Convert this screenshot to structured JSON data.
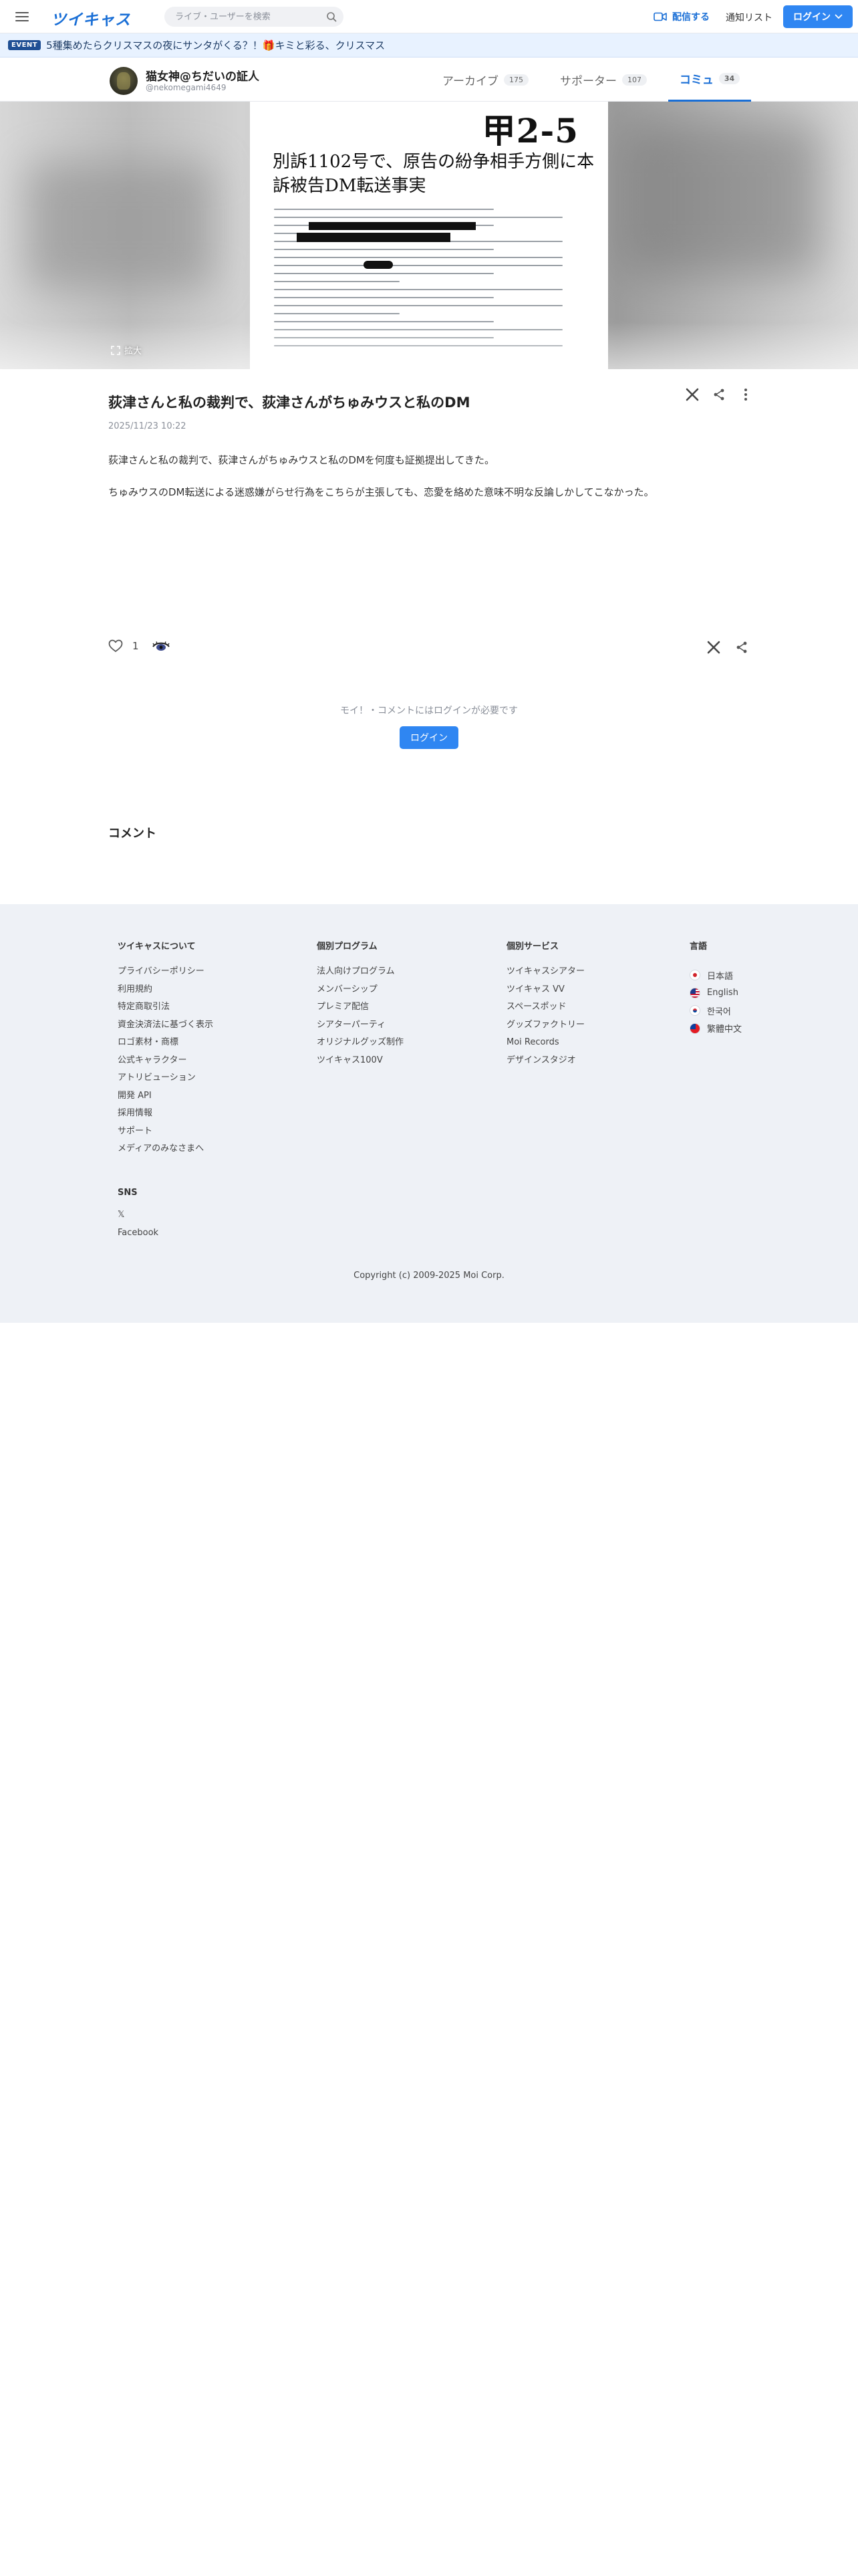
{
  "header": {
    "logo": "ツイキャス",
    "search_placeholder": "ライブ・ユーザーを検索",
    "stream_label": "配信する",
    "notify_label": "通知リスト",
    "login_label": "ログイン"
  },
  "event": {
    "badge": "EVENT",
    "text": "5種集めたらクリスマスの夜にサンタがくる？！🎁キミと彩る、クリスマス"
  },
  "profile": {
    "name": "猫女神@ちだいの証人",
    "user_id": "@nekomegami4649",
    "tabs": [
      {
        "label": "アーカイブ",
        "count": "175"
      },
      {
        "label": "サポーター",
        "count": "107"
      },
      {
        "label": "コミュ",
        "count": "34"
      }
    ]
  },
  "hero": {
    "doc_code": "甲2-5",
    "doc_title": "別訴1102号で、原告の紛争相手方側に本訴被告DM転送事実",
    "expand_label": "拡大"
  },
  "post": {
    "title": "荻津さんと私の裁判で、荻津さんがちゅみウスと私のDM",
    "date": "2025/11/23 10:22",
    "paragraphs": [
      "荻津さんと私の裁判で、荻津さんがちゅみウスと私のDMを何度も証拠提出してきた。",
      "ちゅみウスのDM転送による迷惑嫌がらせ行為をこちらが主張しても、恋愛を絡めた意味不明な反論しかしてこなかった。"
    ],
    "like_count": "1"
  },
  "comments": {
    "login_note": "モイ！・コメントにはログインが必要です",
    "login_button": "ログイン",
    "heading": "コメント"
  },
  "footer": {
    "col1": {
      "heading": "ツイキャスについて",
      "links": [
        "プライバシーポリシー",
        "利用規約",
        "特定商取引法",
        "資金決済法に基づく表示",
        "ロゴ素材・商標",
        "公式キャラクター",
        "アトリビューション",
        "開発 API",
        "採用情報",
        "サポート",
        "メディアのみなさまへ"
      ]
    },
    "col2": {
      "heading": "個別プログラム",
      "links": [
        "法人向けプログラム",
        "メンバーシップ",
        "プレミア配信",
        "シアターパーティ",
        "オリジナルグッズ制作",
        "ツイキャス100V"
      ]
    },
    "col3": {
      "heading": "個別サービス",
      "links": [
        "ツイキャスシアター",
        "ツイキャス VV",
        "スペースポッド",
        "グッズファクトリー",
        "Moi Records",
        "デザインスタジオ"
      ]
    },
    "col4": {
      "heading": "言語",
      "langs": [
        "日本語",
        "English",
        "한국어",
        "繁體中文"
      ]
    },
    "sns": {
      "heading": "SNS",
      "links": [
        "𝕏",
        "Facebook"
      ]
    },
    "copyright": "Copyright (c) 2009-2025 Moi Corp."
  },
  "colors": {
    "brand": "#1a6fd6",
    "button": "#2f86f2",
    "footer_bg": "#eef1f6",
    "event_bg": "#e8f2ff"
  },
  "icons": [
    "menu-icon",
    "search-icon",
    "video-camera-icon",
    "chevron-down-icon",
    "expand-icon",
    "x-logo-icon",
    "share-icon",
    "more-vertical-icon",
    "heart-icon",
    "eye-icon",
    "flag-jp-icon",
    "flag-us-icon",
    "flag-kr-icon",
    "flag-tw-icon"
  ]
}
